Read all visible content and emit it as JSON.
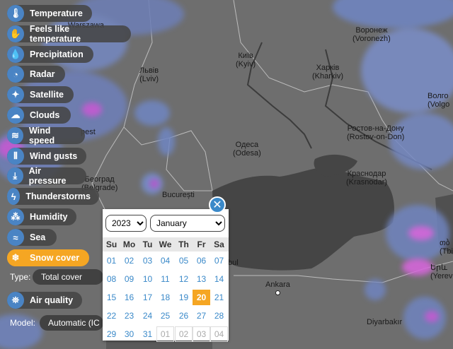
{
  "layers": [
    {
      "label": "Temperature",
      "icon": "thermometer-icon",
      "glyph": "🌡"
    },
    {
      "label": "Feels like temperature",
      "icon": "feels-like-icon",
      "glyph": "✋"
    },
    {
      "label": "Precipitation",
      "icon": "droplets-icon",
      "glyph": "💧"
    },
    {
      "label": "Radar",
      "icon": "radar-icon",
      "glyph": "◔"
    },
    {
      "label": "Satellite",
      "icon": "satellite-icon",
      "glyph": "✦"
    },
    {
      "label": "Clouds",
      "icon": "cloud-icon",
      "glyph": "☁"
    },
    {
      "label": "Wind speed",
      "icon": "wind-icon",
      "glyph": "≋"
    },
    {
      "label": "Wind gusts",
      "icon": "wind-gusts-icon",
      "glyph": "⦀"
    },
    {
      "label": "Air pressure",
      "icon": "pressure-icon",
      "glyph": "⤓"
    },
    {
      "label": "Thunderstorms",
      "icon": "lightning-icon",
      "glyph": "ϟ"
    },
    {
      "label": "Humidity",
      "icon": "humidity-icon",
      "glyph": "⁂"
    },
    {
      "label": "Sea",
      "icon": "waves-icon",
      "glyph": "≈"
    },
    {
      "label": "Snow cover",
      "icon": "snowflake-icon",
      "glyph": "❄"
    },
    {
      "label": "Air quality",
      "icon": "air-quality-icon",
      "glyph": "⛯"
    }
  ],
  "type_label": "Type:",
  "type_value": "Total cover",
  "model_label": "Model:",
  "model_value": "Automatic (IC",
  "calendar": {
    "year": "2023",
    "month": "January",
    "weekdays": [
      "Su",
      "Mo",
      "Tu",
      "We",
      "Th",
      "Fr",
      "Sa"
    ],
    "weeks": [
      [
        "01",
        "02",
        "03",
        "04",
        "05",
        "06",
        "07"
      ],
      [
        "08",
        "09",
        "10",
        "11",
        "12",
        "13",
        "14"
      ],
      [
        "15",
        "16",
        "17",
        "18",
        "19",
        "20",
        "21"
      ],
      [
        "22",
        "23",
        "24",
        "25",
        "26",
        "27",
        "28"
      ],
      [
        "29",
        "30",
        "31",
        "01",
        "02",
        "03",
        "04"
      ]
    ],
    "selected": "20",
    "close_glyph": "✕"
  },
  "cities": {
    "warsaw": "Warszawa",
    "voronezh_1": "Воронеж",
    "voronezh_2": "(Voronezh)",
    "lviv_1": "Львів",
    "lviv_2": "(Lviv)",
    "kyiv_1": "Київ",
    "kyiv_2": "(Kyiv)",
    "kharkiv_1": "Харків",
    "kharkiv_2": "(Kharkiv)",
    "volgograd_1": "Волго",
    "volgograd_2": "(Volgo",
    "rostov_1": "Ростов-на-Дону",
    "rostov_2": "(Rostov-on-Don)",
    "odesa_1": "Одеса",
    "odesa_2": "(Odesa)",
    "budapest": "pest",
    "krasnodar_1": "Краснодар",
    "krasnodar_2": "(Krasnodar)",
    "belgrade_1": "Београд",
    "belgrade_2": "(Belgrade)",
    "bucuresti": "București",
    "tbilisi_1": "თბ",
    "tbilisi_2": "(Tbi",
    "yerevan_1": "Երև",
    "yerevan_2": "(Yerev",
    "istanbul": "bul",
    "ankara": "Ankara",
    "diyarbakir": "Diyarbakır"
  }
}
